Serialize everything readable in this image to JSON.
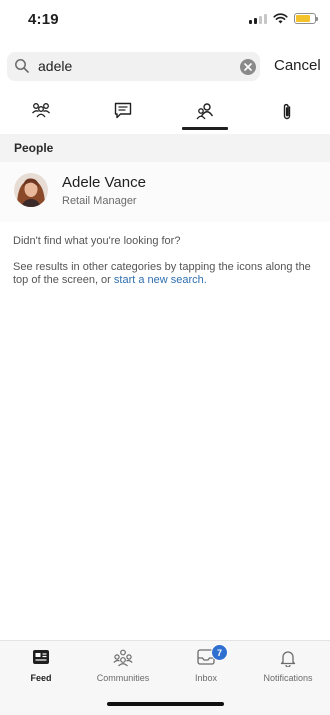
{
  "status_bar": {
    "time": "4:19",
    "icons": [
      "signal-icon",
      "wifi-icon",
      "battery-icon"
    ],
    "battery_color": "#f4c22b"
  },
  "search": {
    "value": "adele",
    "cancel_label": "Cancel",
    "icons": [
      "search-icon",
      "clear-icon"
    ]
  },
  "tabs": [
    {
      "icon": "groups-icon",
      "active": false
    },
    {
      "icon": "conversations-icon",
      "active": false
    },
    {
      "icon": "people-icon",
      "active": true
    },
    {
      "icon": "files-icon",
      "active": false
    }
  ],
  "people": {
    "header": "People",
    "results": [
      {
        "name": "Adele Vance",
        "title": "Retail Manager",
        "icon": "avatar"
      }
    ]
  },
  "empty_hint": {
    "question": "Didn't find what you're looking for?",
    "detail_prefix": "See results in other categories by tapping the icons along the top of the screen, or ",
    "link_text": "start a new search."
  },
  "bottom_nav": {
    "items": [
      {
        "label": "Feed",
        "icon": "feed-icon",
        "active": true
      },
      {
        "label": "Communities",
        "icon": "communities-icon",
        "active": false
      },
      {
        "label": "Inbox",
        "icon": "inbox-icon",
        "active": false,
        "badge": "7"
      },
      {
        "label": "Notifications",
        "icon": "bell-icon",
        "active": false
      }
    ]
  },
  "colors": {
    "accent": "#2f6fb0",
    "badge": "#2f6fd0",
    "section_bg": "#f3f3f3"
  }
}
